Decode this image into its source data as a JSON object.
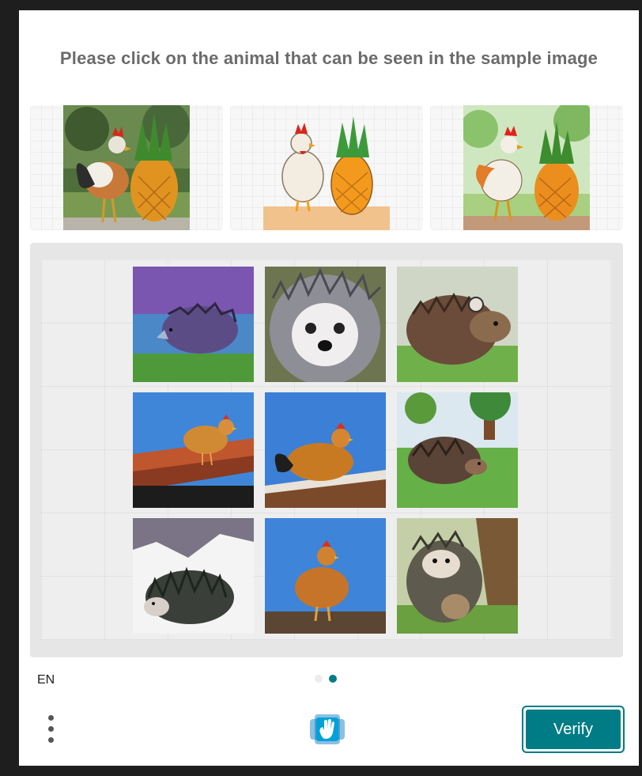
{
  "prompt": "Please click on the animal that can be seen in the sample image",
  "samples": [
    {
      "name": "sample-rooster-pineapple-park"
    },
    {
      "name": "sample-hen-pineapple-cartoon"
    },
    {
      "name": "sample-rooster-pineapple-garden"
    }
  ],
  "tiles": [
    {
      "subject": "hedgehog"
    },
    {
      "subject": "hedgehog"
    },
    {
      "subject": "hedgehog"
    },
    {
      "subject": "chicken"
    },
    {
      "subject": "chicken"
    },
    {
      "subject": "hedgehog"
    },
    {
      "subject": "hedgehog"
    },
    {
      "subject": "chicken"
    },
    {
      "subject": "hedgehog"
    }
  ],
  "footer": {
    "language": "EN",
    "verify_label": "Verify",
    "pagination": {
      "current": 2,
      "total": 2
    }
  },
  "colors": {
    "accent": "#007c86",
    "text_muted": "#6b6b6b"
  }
}
